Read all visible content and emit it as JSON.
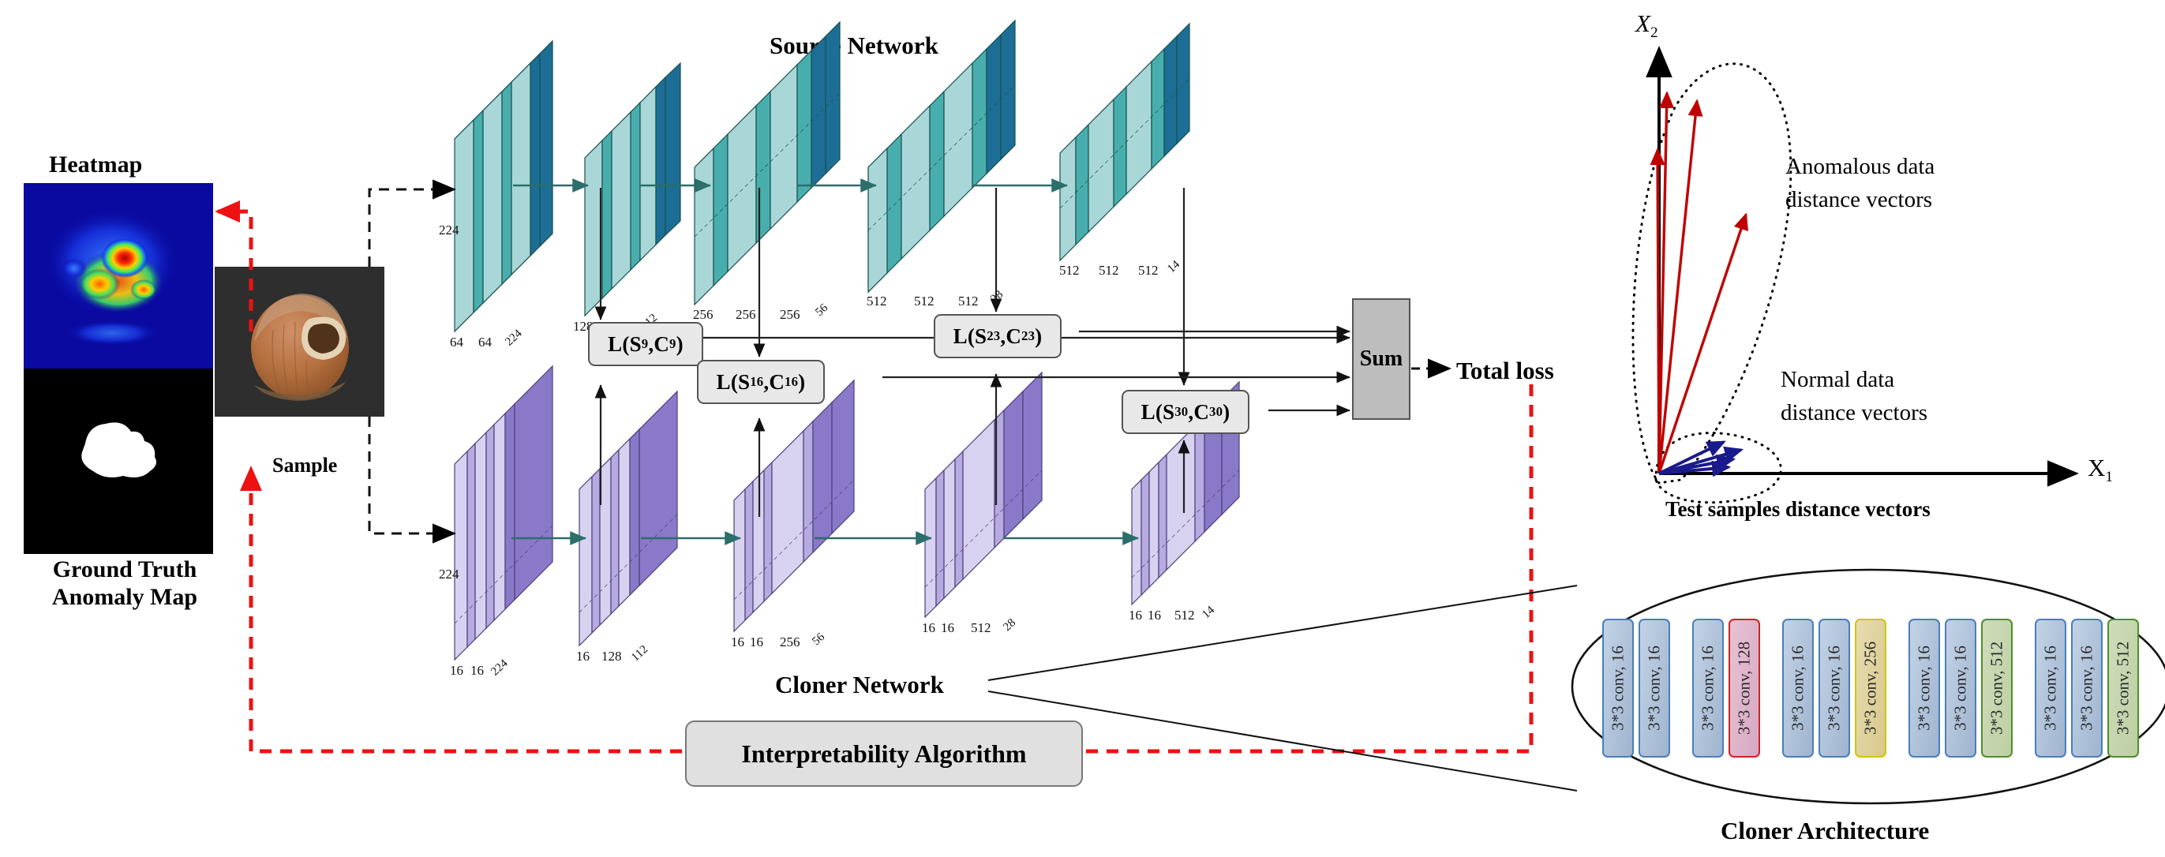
{
  "titles": {
    "heatmap": "Heatmap",
    "ground_truth": "Ground Truth\nAnomaly Map",
    "sample": "Sample",
    "source_network": "Source Network",
    "cloner_network": "Cloner Network",
    "total_loss": "Total loss",
    "cloner_architecture": "Cloner Architecture",
    "test_samples": "Test samples distance vectors",
    "interpretability": "Interpretability Algorithm",
    "sum": "Sum"
  },
  "colors": {
    "source_light": "#a9d7d7",
    "source_mid": "#48adad",
    "source_dark": "#1d6e96",
    "cloner_light": "#d8d2f1",
    "cloner_mid": "#b6aae1",
    "cloner_dark": "#8a79c9",
    "red_dashed": "#ee1111",
    "anomalous_vector": "#c00000",
    "normal_vector": "#1a1a8c",
    "loss_box": "#e8e8e8",
    "sum_box": "#bdbdbd"
  },
  "source_blocks": [
    {
      "id": "s1",
      "slabs": [
        "64",
        "64"
      ],
      "depth": "224"
    },
    {
      "id": "s2",
      "slabs": [
        "128",
        "128"
      ],
      "depth": "112"
    },
    {
      "id": "s3",
      "slabs": [
        "256",
        "256",
        "256"
      ],
      "depth": "56"
    },
    {
      "id": "s4",
      "slabs": [
        "512",
        "512",
        "512"
      ],
      "depth": "28"
    },
    {
      "id": "s5",
      "slabs": [
        "512",
        "512",
        "512"
      ],
      "depth": "14"
    }
  ],
  "source_input_size": "224",
  "cloner_blocks": [
    {
      "id": "c1",
      "slabs": [
        "16",
        "16"
      ],
      "depth": "224"
    },
    {
      "id": "c2",
      "slabs": [
        "16",
        "128"
      ],
      "depth": "112"
    },
    {
      "id": "c3",
      "slabs": [
        "16",
        "16",
        "256"
      ],
      "depth": "56"
    },
    {
      "id": "c4",
      "slabs": [
        "16",
        "16",
        "512"
      ],
      "depth": "28"
    },
    {
      "id": "c5",
      "slabs": [
        "16",
        "16",
        "512"
      ],
      "depth": "14"
    }
  ],
  "cloner_input_size": "224",
  "loss_boxes": [
    {
      "id": "l9",
      "main": "L(S",
      "sub1": "9",
      "mid": ",C",
      "sub2": "9",
      "end": ")"
    },
    {
      "id": "l16",
      "main": "L(S",
      "sub1": "16",
      "mid": ",C",
      "sub2": "16",
      "end": ")"
    },
    {
      "id": "l23",
      "main": "L(S",
      "sub1": "23",
      "mid": ",C",
      "sub2": "23",
      "end": ")"
    },
    {
      "id": "l30",
      "main": "L(S",
      "sub1": "30",
      "mid": ",C",
      "sub2": "30",
      "end": ")"
    }
  ],
  "cloner_architecture_chips": [
    {
      "label": "3*3 conv, 16",
      "style": "blue"
    },
    {
      "label": "3*3 conv, 16",
      "style": "blue"
    },
    {
      "label": "3*3 conv, 16",
      "style": "blue"
    },
    {
      "label": "3*3 conv, 128",
      "style": "red"
    },
    {
      "label": "3*3 conv, 16",
      "style": "blue"
    },
    {
      "label": "3*3 conv, 16",
      "style": "blue"
    },
    {
      "label": "3*3 conv, 256",
      "style": "yellow"
    },
    {
      "label": "3*3 conv, 16",
      "style": "blue"
    },
    {
      "label": "3*3 conv, 16",
      "style": "blue"
    },
    {
      "label": "3*3 conv, 512",
      "style": "green"
    },
    {
      "label": "3*3 conv, 16",
      "style": "blue"
    },
    {
      "label": "3*3 conv, 16",
      "style": "blue"
    },
    {
      "label": "3*3 conv, 512",
      "style": "green"
    }
  ],
  "vector_plot": {
    "axis_x": "X",
    "axis_x_sub": "1",
    "axis_y": "X",
    "axis_y_sub": "2",
    "anomalous_label": "Anomalous data\ndistance vectors",
    "normal_label": "Normal data\ndistance vectors",
    "anomalous_count": 4,
    "normal_count": 4
  }
}
